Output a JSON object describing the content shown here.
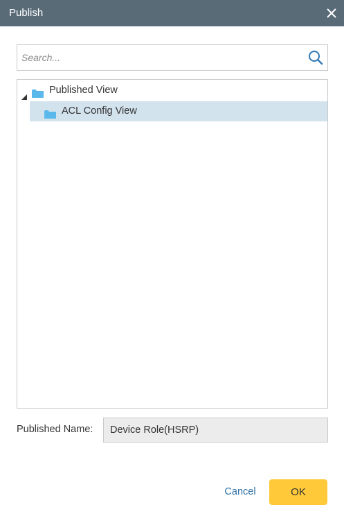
{
  "dialog": {
    "title": "Publish"
  },
  "search": {
    "placeholder": "Search...",
    "value": ""
  },
  "tree": {
    "root": {
      "label": "Published View",
      "expanded": true
    },
    "children": [
      {
        "label": "ACL Config View",
        "selected": true
      }
    ]
  },
  "published_name": {
    "label": "Published Name:",
    "value": "Device Role(HSRP)"
  },
  "footer": {
    "cancel_label": "Cancel",
    "ok_label": "OK"
  },
  "colors": {
    "titlebar": "#5a6b78",
    "accent": "#ffc93a",
    "selection": "#d3e3ee",
    "folder": "#5ab9ea",
    "link": "#2e6fa3"
  },
  "icons": {
    "close": "close-icon",
    "search": "search-icon",
    "expander": "triangle-expanded-icon",
    "folder": "folder-icon"
  }
}
